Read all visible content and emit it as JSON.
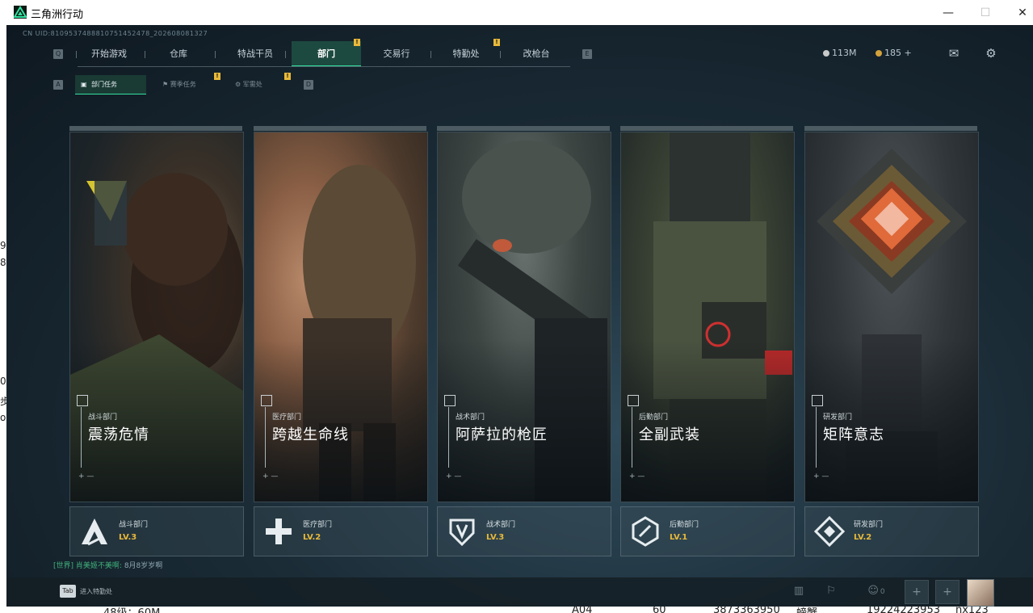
{
  "window": {
    "title": "三角洲行动",
    "minimize": "—",
    "maximize": "☐",
    "close": "✕"
  },
  "uid": "CN UID:8109537488810751452478_202608081327",
  "topnav": {
    "key_left": "Q",
    "key_right": "E",
    "items": [
      {
        "label": "开始游戏"
      },
      {
        "label": "仓库"
      },
      {
        "label": "特战干员"
      },
      {
        "label": "部门"
      },
      {
        "label": "交易行"
      },
      {
        "label": "特勤处"
      },
      {
        "label": "改枪台"
      }
    ],
    "active": "部门",
    "badges": [
      "!",
      "!"
    ]
  },
  "subnav": {
    "key_left": "A",
    "key_right": "D",
    "items": [
      {
        "label": "部门任务"
      },
      {
        "label": "赛季任务"
      },
      {
        "label": "军需处"
      }
    ],
    "badges": [
      "!",
      "!"
    ]
  },
  "resources": {
    "currency1": "113M",
    "currency2": "185 +",
    "colors": {
      "currency1": "#c9c9c9",
      "currency2": "#d4a23c"
    }
  },
  "cards": [
    {
      "category": "战斗部门",
      "title": "震荡危情",
      "badge_name": "战斗部门",
      "level": "LV.3",
      "icon": "combat-icon"
    },
    {
      "category": "医疗部门",
      "title": "跨越生命线",
      "badge_name": "医疗部门",
      "level": "LV.2",
      "icon": "medical-cross-icon"
    },
    {
      "category": "战术部门",
      "title": "阿萨拉的枪匠",
      "badge_name": "战术部门",
      "level": "LV.3",
      "icon": "shield-icon"
    },
    {
      "category": "后勤部门",
      "title": "全副武装",
      "badge_name": "后勤部门",
      "level": "LV.1",
      "icon": "hexagon-icon"
    },
    {
      "category": "研发部门",
      "title": "矩阵意志",
      "badge_name": "研发部门",
      "level": "LV.2",
      "icon": "diamond-icon"
    }
  ],
  "chat": {
    "channel": "[世界]",
    "user": "肖美姬不美啊:",
    "message": "8月8岁岁啊"
  },
  "bottombar": {
    "tab_key": "Tab",
    "tab_label": "进入特勤处",
    "friends_count": "0"
  },
  "accent": "#33e0a0",
  "level_color": "#e8b93a"
}
